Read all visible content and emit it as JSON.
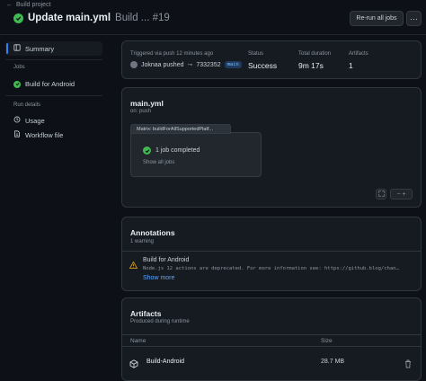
{
  "header": {
    "back_label": "Build project",
    "title_main": "Update main.yml",
    "title_rest": "Build ... #19",
    "rerun_label": "Re-run all jobs",
    "more_label": "···"
  },
  "sidebar": {
    "summary_label": "Summary",
    "jobs_heading": "Jobs",
    "job_label": "Build for Android",
    "run_details_heading": "Run details",
    "usage_label": "Usage",
    "workflow_file_label": "Workflow file"
  },
  "summary": {
    "trigger_label": "Triggered via push 12 minutes ago",
    "actor": "Joknaa pushed",
    "commit": "7332352",
    "branch": "main",
    "status_label": "Status",
    "status_value": "Success",
    "duration_label": "Total duration",
    "duration_value": "9m 17s",
    "artifacts_label": "Artifacts",
    "artifacts_value": "1"
  },
  "workflow": {
    "file_name": "main.yml",
    "trigger": "on: push",
    "matrix_label": "Matrix: buildForAllSupportedPlatf...",
    "job_completed": "1 job completed",
    "show_all": "Show all jobs",
    "zoom_value": "−  +"
  },
  "annotations": {
    "title": "Annotations",
    "count": "1 warning",
    "item_title": "Build for Android",
    "item_text": "Node.js 12 actions are deprecated. For more information see: https://github.blog/chan…",
    "show_more": "Show more"
  },
  "artifacts": {
    "title": "Artifacts",
    "subtitle": "Produced during runtime",
    "col_name": "Name",
    "col_size": "Size",
    "rows": [
      {
        "name": "Build-Android",
        "size": "28.7 MB"
      }
    ]
  },
  "colors": {
    "success": "#3fb950",
    "warning": "#d29922",
    "link": "#58a6ff",
    "accent": "#2f81f7"
  }
}
